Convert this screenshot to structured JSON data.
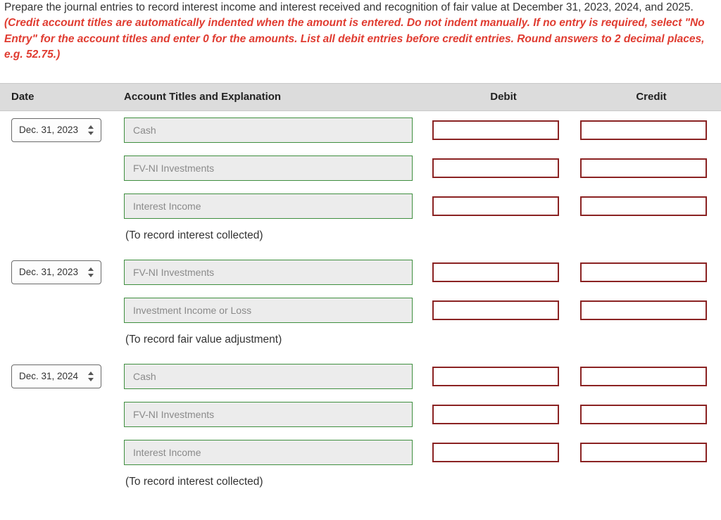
{
  "prompt": {
    "plain": "Prepare the journal entries to record interest income and interest received and recognition of fair value at December 31, 2023, 2024, and 2025. ",
    "red": "(Credit account titles are automatically indented when the amount is entered. Do not indent manually. If no entry is required, select \"No Entry\" for the account titles and enter 0 for the amounts. List all debit entries before credit entries. Round answers to 2 decimal places, e.g. 52.75.)"
  },
  "headers": {
    "date": "Date",
    "account": "Account Titles and Explanation",
    "debit": "Debit",
    "credit": "Credit"
  },
  "entries": [
    {
      "date": "Dec. 31, 2023",
      "lines": [
        {
          "account": "Cash"
        },
        {
          "account": "FV-NI Investments"
        },
        {
          "account": "Interest Income"
        }
      ],
      "memo": "(To record interest collected)"
    },
    {
      "date": "Dec. 31, 2023",
      "lines": [
        {
          "account": "FV-NI Investments"
        },
        {
          "account": "Investment Income or Loss"
        }
      ],
      "memo": "(To record fair value adjustment)"
    },
    {
      "date": "Dec. 31, 2024",
      "lines": [
        {
          "account": "Cash"
        },
        {
          "account": "FV-NI Investments"
        },
        {
          "account": "Interest Income"
        }
      ],
      "memo": "(To record interest collected)"
    }
  ]
}
